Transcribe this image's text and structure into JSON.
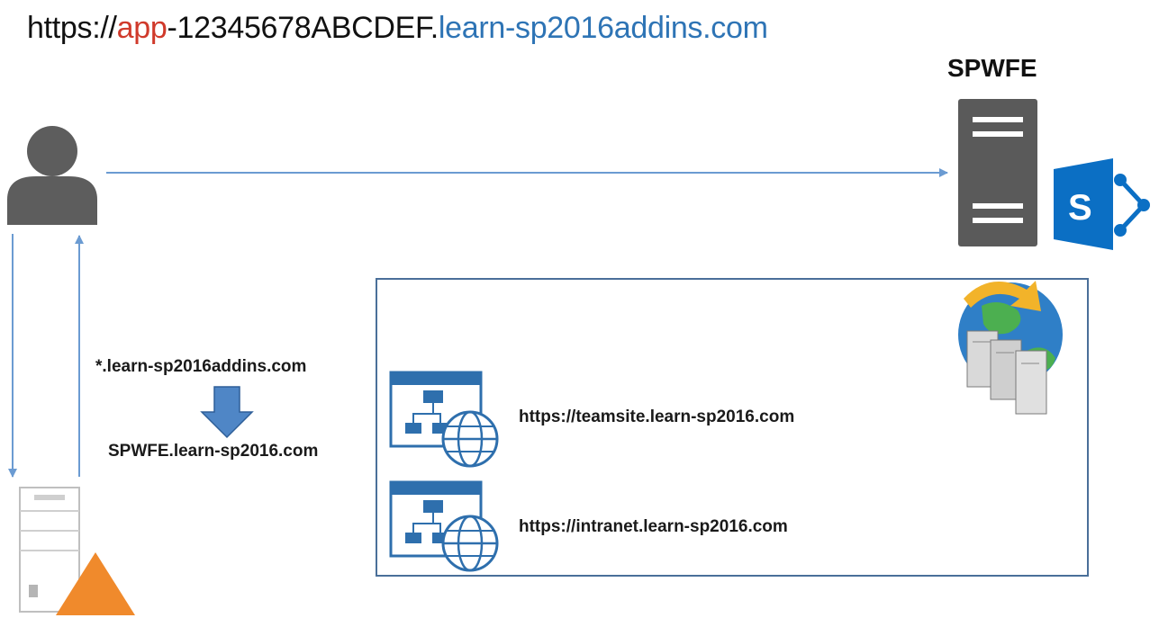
{
  "url": {
    "scheme": "https://",
    "app_prefix": "app",
    "app_id": "-12345678ABCDEF.",
    "domain": "learn-sp2016addins.com",
    "colors": {
      "prefix": "#d03a2b",
      "domain": "#2e74b5",
      "text": "#111111"
    }
  },
  "server": {
    "label": "SPWFE",
    "product_icon": "sharepoint-icon"
  },
  "dns": {
    "source": "*.learn-sp2016addins.com",
    "target": "SPWFE.learn-sp2016.com",
    "arrow_icon": "down-arrow-icon"
  },
  "sites": [
    {
      "url": "https://teamsite.learn-sp2016.com",
      "icon": "website-globe-icon"
    },
    {
      "url": "https://intranet.learn-sp2016.com",
      "icon": "website-globe-icon"
    }
  ],
  "icons": {
    "user": "user-icon",
    "dns_server": "dns-server-warning-icon",
    "web_farm": "web-server-globe-icon",
    "web_server": "web-server-tower-icon"
  },
  "colors": {
    "arrow": "#6b9bd2",
    "box_border": "#4a6f99",
    "icon_blue": "#2e6fad",
    "sharepoint": "#0072c6",
    "warning": "#f08a2c"
  }
}
